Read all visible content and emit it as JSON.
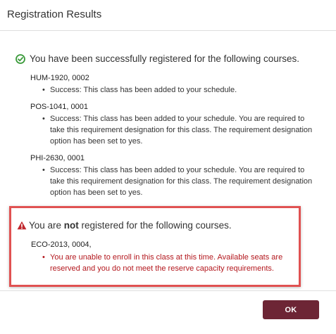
{
  "dialog": {
    "title": "Registration Results"
  },
  "success": {
    "icon": "check-circle-icon",
    "color": "#3a9a3a",
    "message": "You have been successfully registered for the following courses.",
    "courses": [
      {
        "code": "HUM-1920, 0002",
        "messages": [
          "Success: This class has been added to your schedule."
        ]
      },
      {
        "code": "POS-1041, 0001",
        "messages": [
          "Success: This class has been added to your schedule.  You are required to take this requirement designation for this class. The requirement designation option has been set to yes."
        ]
      },
      {
        "code": "PHI-2630, 0001",
        "messages": [
          "Success: This class has been added to your schedule.  You are required to take this requirement designation for this class. The requirement designation option has been set to yes."
        ]
      }
    ]
  },
  "failure": {
    "icon": "warning-icon",
    "color": "#c0272d",
    "message_prefix": "You are ",
    "message_emphasis": "not",
    "message_suffix": " registered for the following courses.",
    "courses": [
      {
        "code": "ECO-2013, 0004,",
        "messages": [
          "You are unable to enroll in this class at this time. Available seats are reserved and you do not meet the reserve capacity requirements."
        ]
      }
    ]
  },
  "footer": {
    "ok_label": "OK",
    "ok_color": "#6d2535"
  }
}
